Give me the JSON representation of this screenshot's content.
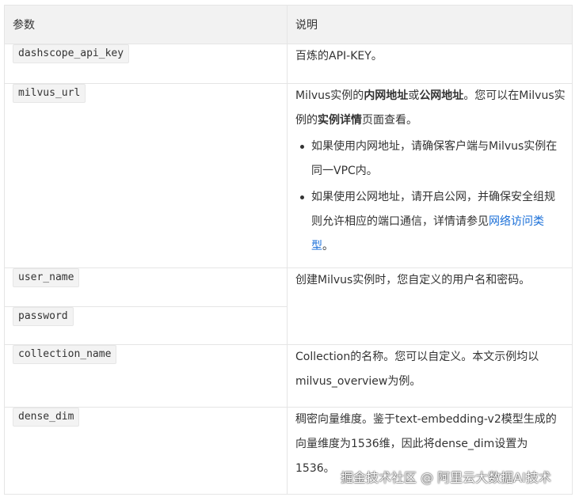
{
  "table": {
    "header": {
      "param": "参数",
      "desc": "说明"
    },
    "rows": {
      "dashscope": {
        "param": "dashscope_api_key",
        "desc": "百炼的API-KEY。"
      },
      "milvus_url": {
        "param": "milvus_url",
        "line1_a": "Milvus实例的",
        "line1_b": "内网地址",
        "line1_c": "或",
        "line1_d": "公网地址",
        "line1_e": "。您可以在Milvus实例的",
        "line1_f": "实例详情",
        "line1_g": "页面查看。",
        "bullet1": "如果使用内网地址，请确保客户端与Milvus实例在同一VPC内。",
        "bullet2_text": "如果使用公网地址，请开启公网，并确保安全组规则允许相应的端口通信，详情请参见",
        "bullet2_link": "网络访问类型",
        "bullet2_end": "。"
      },
      "user_name": {
        "param": "user_name",
        "desc": "创建Milvus实例时，您自定义的用户名和密码。"
      },
      "password": {
        "param": "password"
      },
      "collection_name": {
        "param": "collection_name",
        "desc": "Collection的名称。您可以自定义。本文示例均以milvus_overview为例。"
      },
      "dense_dim": {
        "param": "dense_dim",
        "desc": "稠密向量维度。鉴于text-embedding-v2模型生成的向量维度为1536维，因此将dense_dim设置为1536。"
      }
    }
  },
  "watermark": "掘金技术社区 @ 阿里云大数据AI技术"
}
